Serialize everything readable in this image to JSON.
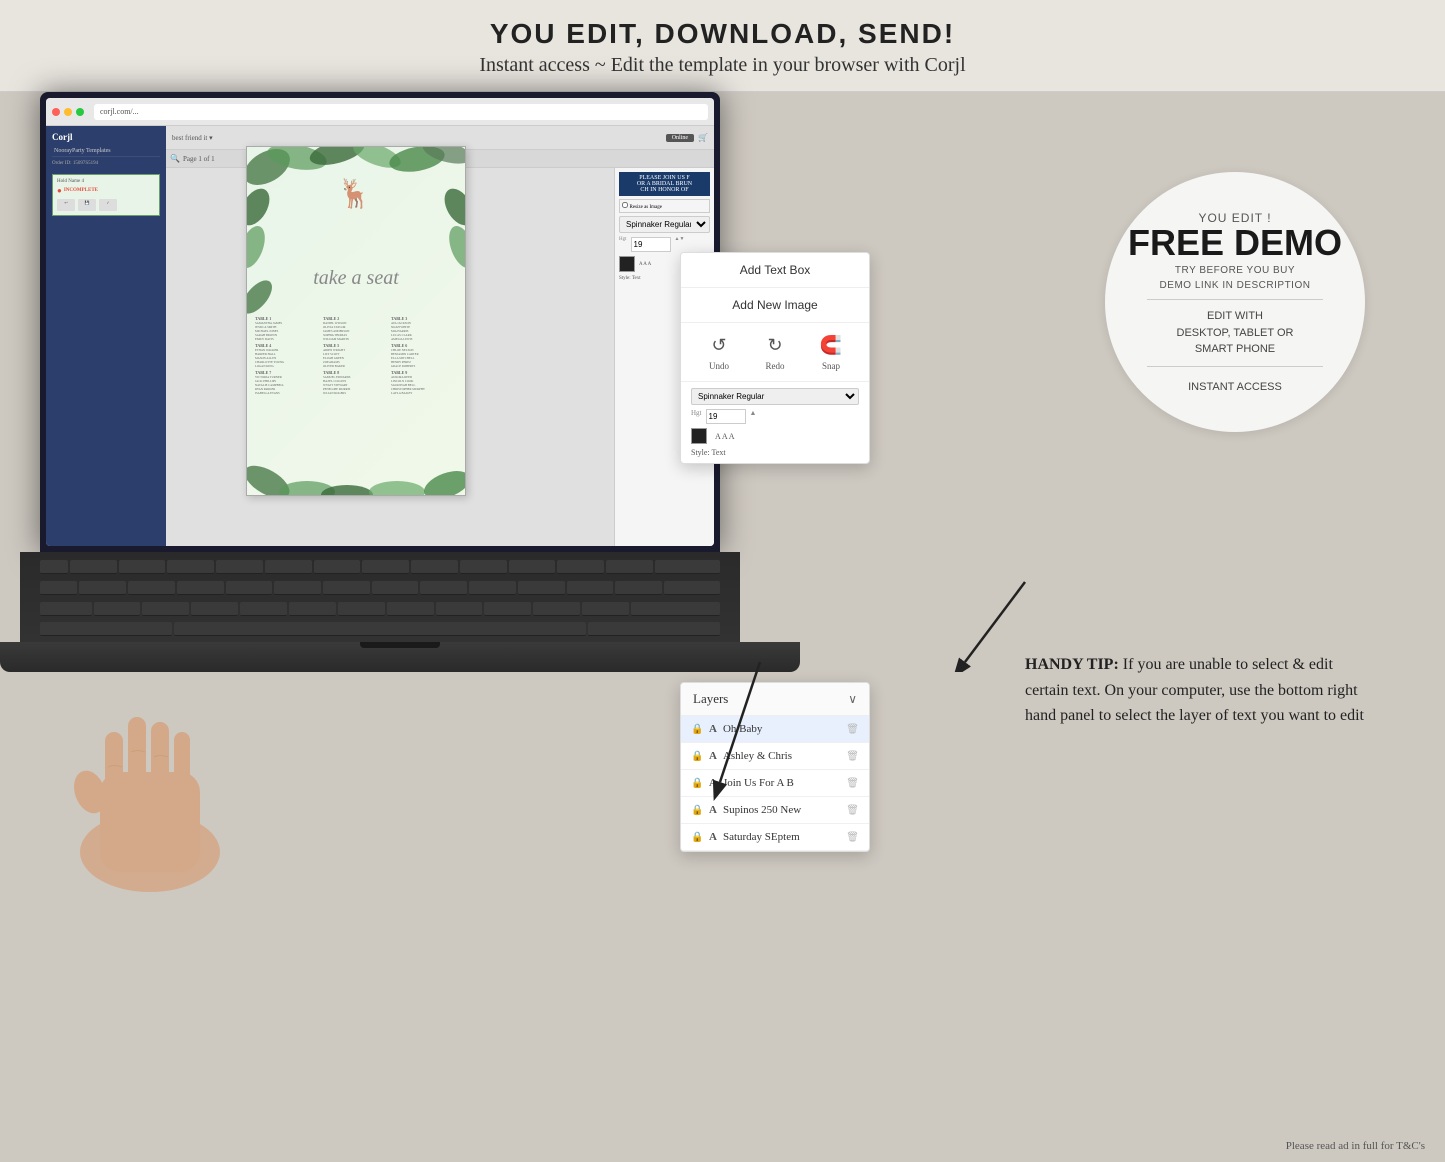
{
  "header": {
    "title": "YOU EDIT, DOWNLOAD, SEND!",
    "subtitle": "Instant access ~ Edit the template in your browser with Corjl"
  },
  "browser": {
    "url": "corjl.com/..."
  },
  "corjl": {
    "logo": "Corjl",
    "brand": "NoorayParty Templates",
    "order_id": "Order ID: 15097S5194",
    "status": "INCOMPLETE"
  },
  "floating_panel": {
    "add_text_box": "Add Text Box",
    "add_new_image": "Add New Image",
    "tools": {
      "undo": "Undo",
      "redo": "Redo",
      "snap": "Snap"
    }
  },
  "layers_panel": {
    "title": "Layers",
    "chevron": "∨",
    "items": [
      {
        "name": "Oh Baby",
        "active": true
      },
      {
        "name": "Ashley & Chris",
        "active": false
      },
      {
        "name": "Join Us For A B",
        "active": false
      },
      {
        "name": "Supinos 250 New",
        "active": false
      },
      {
        "name": "Saturday SEptem",
        "active": false
      }
    ]
  },
  "free_demo": {
    "you_edit": "YOU EDIT !",
    "free_demo": "FREE DEMO",
    "try_before": "TRY BEFORE YOU BUY",
    "demo_link": "DEMO LINK IN DESCRIPTION",
    "edit_with": "EDIT WITH\nDESKTOP, TABLET OR\nSMART PHONE",
    "instant_access": "INSTANT ACCESS"
  },
  "handy_tip": {
    "label": "HANDY TIP:",
    "text": " If you are unable to select & edit certain text. On your computer, use the bottom right hand panel to select the layer of text you want to edit"
  },
  "canvas": {
    "take_a_seat": "take a seat",
    "tables": [
      "TABLE 1",
      "TABLE 2",
      "TABLE 3",
      "TABLE 4",
      "TABLE 5",
      "TABLE 6",
      "TABLE 7",
      "TABLE 8",
      "TABLE 9"
    ]
  },
  "footer": {
    "credit": "Please read ad in full for T&C's"
  },
  "colors": {
    "header_bg": "#e8e4de",
    "main_bg": "#cdc8c0",
    "circle_bg": "#f5f5f3",
    "accent_blue": "#2c3e6b",
    "leaf_green": "#5a8a5a"
  }
}
